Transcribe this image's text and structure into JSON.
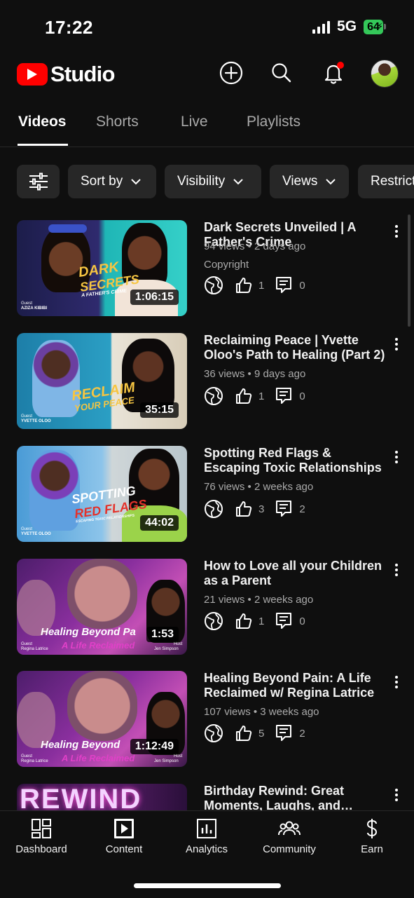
{
  "status_bar": {
    "time": "17:22",
    "network": "5G",
    "battery": "64"
  },
  "header": {
    "brand": "Studio"
  },
  "tabs": [
    {
      "label": "Videos"
    },
    {
      "label": "Shorts"
    },
    {
      "label": "Live"
    },
    {
      "label": "Playlists"
    }
  ],
  "filters": [
    {
      "label": "Sort by"
    },
    {
      "label": "Visibility"
    },
    {
      "label": "Views"
    },
    {
      "label": "Restrictions"
    }
  ],
  "videos": [
    {
      "title": "Dark Secrets Unveiled | A Father's Crime",
      "meta": "94 views • 2 days ago",
      "note": "Copyright",
      "likes": "1",
      "comments": "0",
      "duration": "1:06:15",
      "thumb_text1": "DARK",
      "thumb_text2": "SECRETS",
      "thumb_sub": "A FATHER'S CRIME",
      "guest": "Guest",
      "guest_name": "AZIZA KIBIBI"
    },
    {
      "title": "Reclaiming Peace | Yvette Oloo's Path to Healing (Part 2)",
      "meta": "36 views • 9 days ago",
      "likes": "1",
      "comments": "0",
      "duration": "35:15",
      "thumb_text1": "RECLAIM",
      "thumb_text2": "YOUR PEACE",
      "guest": "Guest",
      "guest_name": "YVETTE OLOO"
    },
    {
      "title": "Spotting Red Flags & Escaping Toxic Relationships",
      "meta": "76 views • 2 weeks ago",
      "likes": "3",
      "comments": "2",
      "duration": "44:02",
      "thumb_text1": "SPOTTING",
      "thumb_text2": "RED FLAGS",
      "thumb_sub": "ESCAPING TOXIC RELATIONSHIPS",
      "guest": "Guest",
      "guest_name": "YVETTE OLOO"
    },
    {
      "title": "How to Love all your Children as a Parent",
      "meta": "21 views • 2 weeks ago",
      "likes": "1",
      "comments": "0",
      "duration": "1:53",
      "thumb_text1": "Healing Beyond Pa",
      "thumb_text2": "A Life Reclaimed",
      "guest": "Guest",
      "guest_name": "Regina Latrice",
      "host": "Host",
      "host_name": "Jen Simpson"
    },
    {
      "title": "Healing Beyond Pain: A Life Reclaimed w/ Regina Latrice",
      "meta": "107 views • 3 weeks ago",
      "likes": "5",
      "comments": "2",
      "duration": "1:12:49",
      "thumb_text1": "Healing Beyond",
      "thumb_text2": "A Life Reclaimed",
      "guest": "Guest",
      "guest_name": "Regina Latrice",
      "host": "Host",
      "host_name": "Jen Simpson"
    },
    {
      "title": "Birthday Rewind: Great Moments, Laughs, and Inspiration",
      "thumb_text1": "REWIND"
    }
  ],
  "bottom_nav": [
    {
      "label": "Dashboard"
    },
    {
      "label": "Content"
    },
    {
      "label": "Analytics"
    },
    {
      "label": "Community"
    },
    {
      "label": "Earn"
    }
  ],
  "colors": {
    "brand_red": "#ff0000",
    "background": "#0f0f0f",
    "chip": "#272727",
    "secondary_text": "#aaaaaa",
    "battery": "#34c759"
  }
}
